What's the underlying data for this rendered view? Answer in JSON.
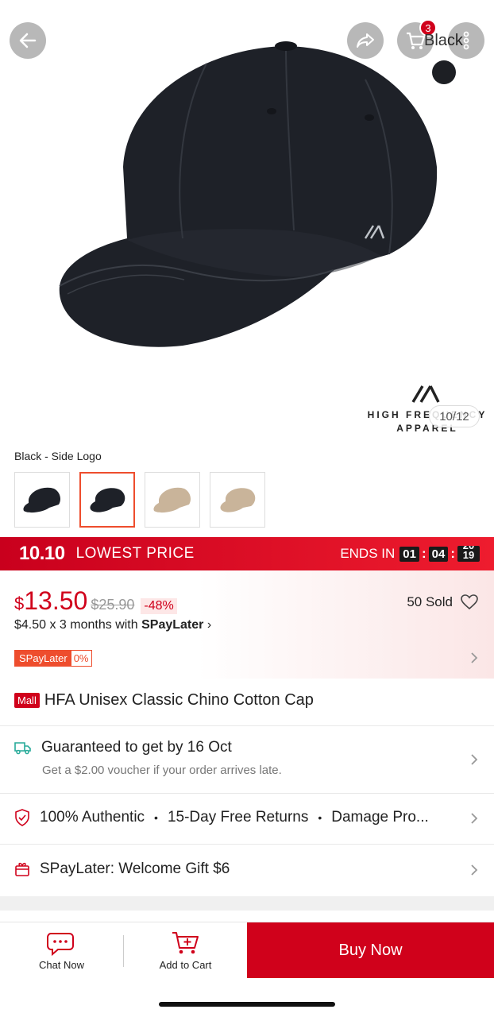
{
  "header": {
    "back_icon": "arrow-left-icon",
    "share_icon": "share-icon",
    "cart_icon": "cart-icon",
    "cart_count": "3",
    "more_icon": "more-vertical-icon",
    "variant_overlay": "Black"
  },
  "gallery": {
    "brand_line1": "HIGH FREQUENCY",
    "brand_line2": "APPAREL",
    "counter": "10/12"
  },
  "variants": {
    "selected_name": "Black - Side Logo",
    "thumbs": [
      "black-cap",
      "black-cap-side",
      "khaki-cap",
      "khaki-cap-side"
    ],
    "selected_index": 1
  },
  "flash_sale": {
    "badge": "10.10",
    "label": "LOWEST PRICE",
    "ends_label": "ENDS IN",
    "hours": "01",
    "minutes": "04",
    "seconds_top": "20",
    "seconds_bottom": "19"
  },
  "price": {
    "currency": "$",
    "amount": "13.50",
    "original": "$25.90",
    "discount": "-48%",
    "sold": "50 Sold",
    "installment_prefix": "$4.50 x 3 months with ",
    "installment_brand": "SPayLater",
    "installment_arrow": "›",
    "badge_left": "SPayLater",
    "badge_right": "0%"
  },
  "product": {
    "mall_tag": "Mall",
    "title": "HFA Unisex Classic Chino Cotton Cap"
  },
  "shipping": {
    "title": "Guaranteed to get by 16 Oct",
    "subtitle": "Get a $2.00 voucher if your order arrives late."
  },
  "assurance": {
    "item1": "100% Authentic",
    "item2": "15-Day Free Returns",
    "item3": "Damage Pro...",
    "dot": "•"
  },
  "promo": {
    "text": "SPayLater: Welcome Gift $6"
  },
  "bottom_bar": {
    "chat_label": "Chat Now",
    "cart_label": "Add to Cart",
    "buy_label": "Buy Now"
  },
  "colors": {
    "accent": "#d0011b",
    "orange": "#ee4d2d"
  }
}
